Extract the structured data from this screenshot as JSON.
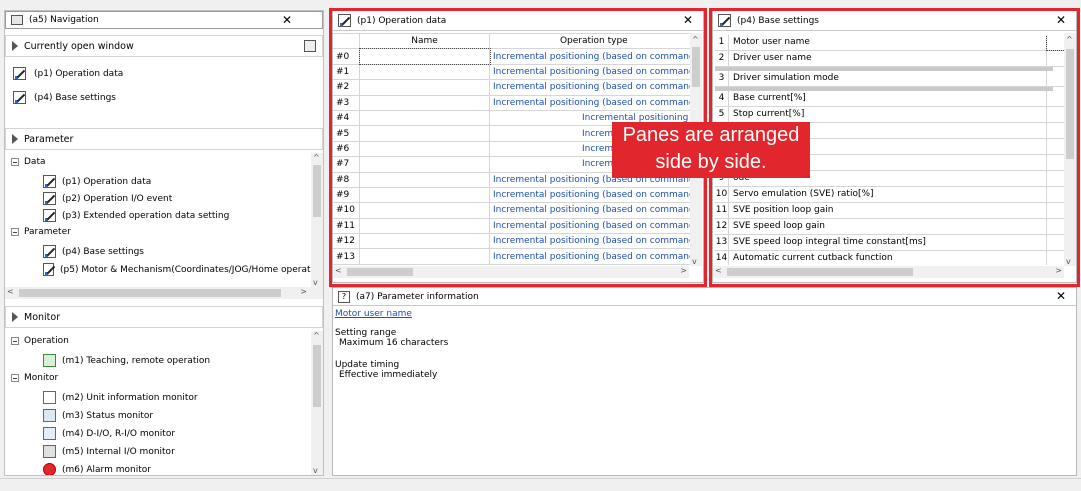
{
  "nav": {
    "title": "(a5) Navigation",
    "current_window": "Currently open window",
    "open_windows": [
      "(p1) Operation data",
      "(p4) Base settings"
    ],
    "parameter_header": "Parameter",
    "tree": {
      "data_group": "Data",
      "data_items": [
        "(p1) Operation data",
        "(p2) Operation I/O event",
        "(p3) Extended operation data setting"
      ],
      "param_group": "Parameter",
      "param_items": [
        "(p4) Base settings",
        "(p5) Motor & Mechanism(Coordinates/JOG/Home operati"
      ]
    },
    "monitor_header": "Monitor",
    "monitor_tree": {
      "operation_group": "Operation",
      "operation_items": [
        "(m1) Teaching, remote operation"
      ],
      "monitor_group": "Monitor",
      "monitor_items": [
        "(m2) Unit information monitor",
        "(m3) Status monitor",
        "(m4) D-I/O, R-I/O monitor",
        "(m5) Internal I/O monitor",
        "(m6) Alarm monitor"
      ]
    }
  },
  "op_data": {
    "title": "(p1) Operation data",
    "col_name": "Name",
    "col_type": "Operation type",
    "rows": [
      {
        "num": "#0",
        "type": "Incremental positioning (based on command"
      },
      {
        "num": "#1",
        "type": "Incremental positioning (based on command"
      },
      {
        "num": "#2",
        "type": "Incremental positioning (based on command"
      },
      {
        "num": "#3",
        "type": "Incremental positioning (based on command"
      },
      {
        "num": "#4",
        "type": "Incremental positioning ("
      },
      {
        "num": "#5",
        "type": "Incremental positioning ("
      },
      {
        "num": "#6",
        "type": "Incremental positioning ("
      },
      {
        "num": "#7",
        "type": "Incremental positioning ("
      },
      {
        "num": "#8",
        "type": "Incremental positioning (based on command"
      },
      {
        "num": "#9",
        "type": "Incremental positioning (based on command"
      },
      {
        "num": "#10",
        "type": "Incremental positioning (based on command"
      },
      {
        "num": "#11",
        "type": "Incremental positioning (based on command"
      },
      {
        "num": "#12",
        "type": "Incremental positioning (based on command"
      },
      {
        "num": "#13",
        "type": "Incremental positioning (based on command"
      }
    ]
  },
  "base_settings": {
    "title": "(p4) Base settings",
    "rows": [
      {
        "num": "1",
        "label": "Motor user name"
      },
      {
        "num": "2",
        "label": "Driver user name"
      },
      {
        "num": "3",
        "label": "Driver simulation mode"
      },
      {
        "num": "4",
        "label": "Base current[%]"
      },
      {
        "num": "5",
        "label": "Stop current[%]"
      },
      {
        "num": "6",
        "label": "tting"
      },
      {
        "num": "7",
        "label": "me constant[ms]"
      },
      {
        "num": "8",
        "label": "tion"
      },
      {
        "num": "9",
        "label": "ode"
      },
      {
        "num": "10",
        "label": "Servo emulation (SVE) ratio[%]"
      },
      {
        "num": "11",
        "label": "SVE position loop gain"
      },
      {
        "num": "12",
        "label": "SVE speed loop gain"
      },
      {
        "num": "13",
        "label": "SVE speed loop integral time constant[ms]"
      },
      {
        "num": "14",
        "label": "Automatic current cutback function"
      }
    ]
  },
  "param_info": {
    "title": "(a7) Parameter information",
    "link": "Motor user name",
    "range_label": "Setting range",
    "range_value": "Maximum 16 characters",
    "timing_label": "Update timing",
    "timing_value": "Effective immediately"
  },
  "callout": {
    "line1": "Panes are arranged",
    "line2": "side by side."
  },
  "colors": {
    "highlight": "#e2262d",
    "link": "#1f4fb0"
  }
}
